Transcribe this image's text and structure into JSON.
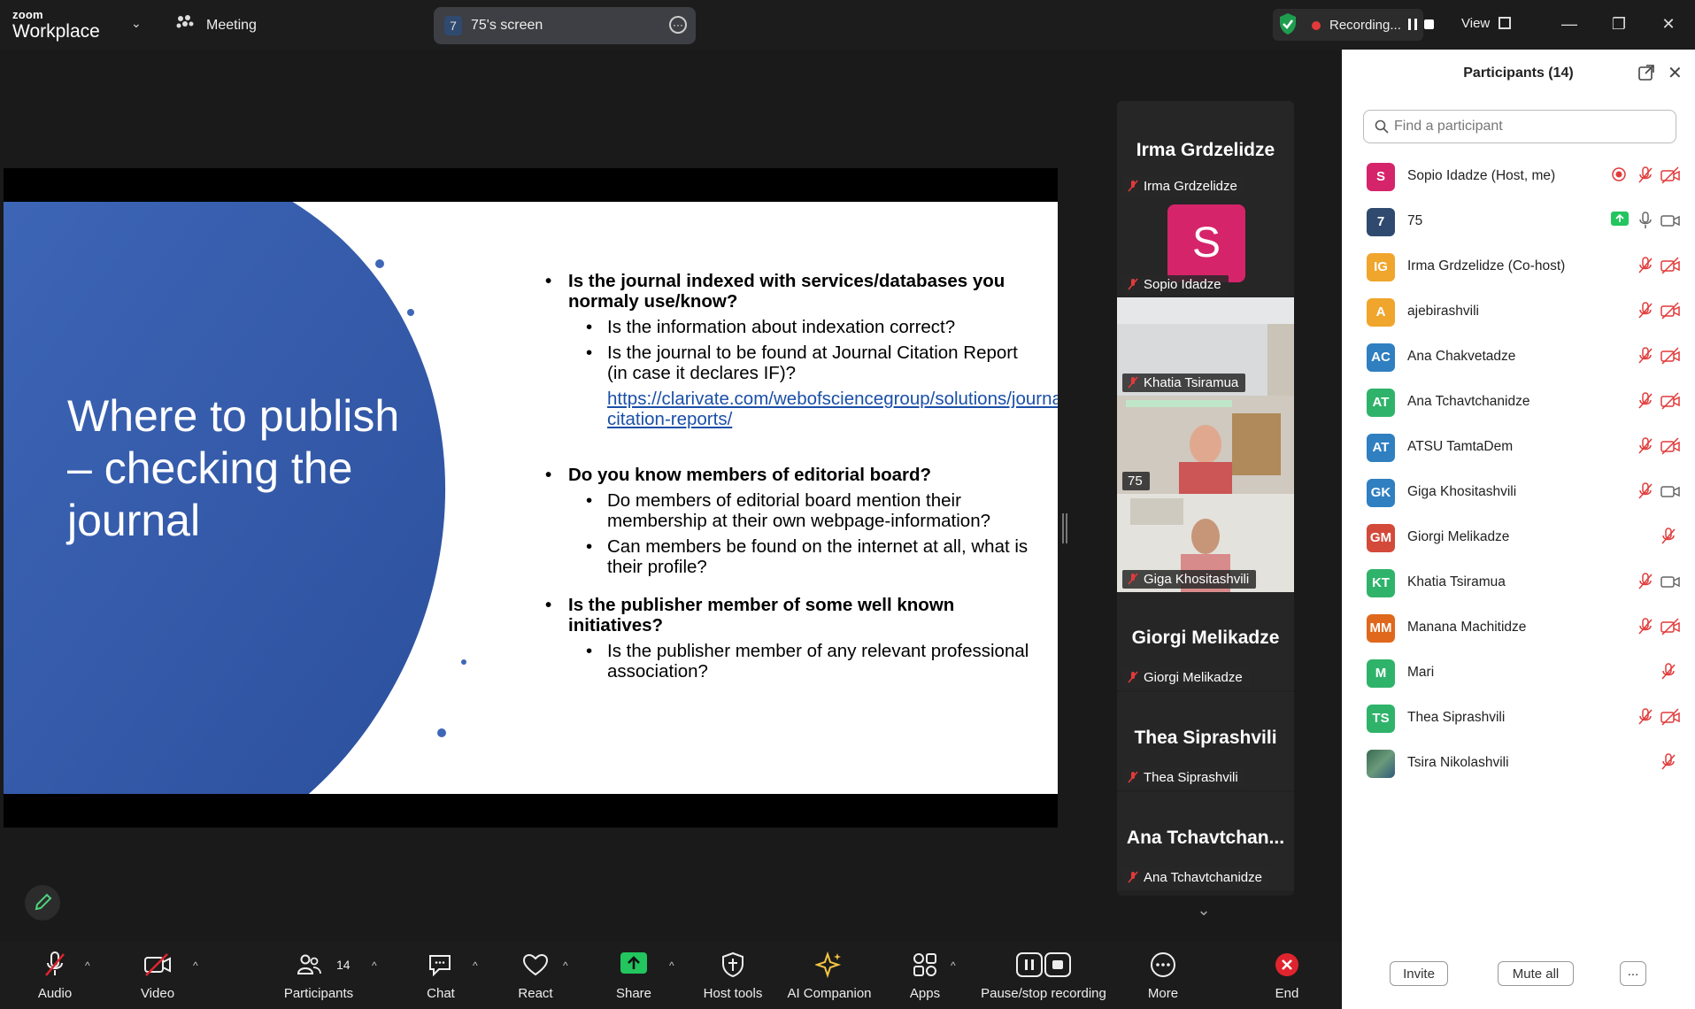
{
  "app": {
    "brand_small": "zoom",
    "brand_large": "Workplace",
    "meeting_label": "Meeting",
    "screen_share": {
      "number": "7",
      "label": "75's screen"
    },
    "recording_label": "Recording...",
    "view_label": "View"
  },
  "slide": {
    "title": "Where to publish – checking the journal",
    "bullets": [
      {
        "text": "Is the journal indexed with services/databases you normaly use/know?",
        "sub": [
          "Is the information about indexation correct?",
          "Is the journal to be found at Journal Citation Report (in case it declares IF)?"
        ],
        "link": "https://clarivate.com/webofsciencegroup/solutions/journal-citation-reports/"
      },
      {
        "text": "Do you know members of editorial board?",
        "sub": [
          "Do members of editorial board mention their membership at their own webpage-information?",
          "Can members be found on the internet at all, what is their profile?"
        ]
      },
      {
        "text": "Is the publisher member of some well known initiatives?",
        "sub": [
          "Is the publisher member of any relevant professional association?"
        ]
      }
    ]
  },
  "gallery": {
    "tiles": [
      {
        "display": "Irma Grdzelidze",
        "tag": "Irma Grdzelidze"
      },
      {
        "avatar": "S",
        "tag": "Sopio Idadze"
      },
      {
        "tag": "Khatia Tsiramua"
      },
      {
        "tag": "75"
      },
      {
        "tag": "Giga Khositashvili"
      },
      {
        "display": "Giorgi Melikadze",
        "tag": "Giorgi Melikadze"
      },
      {
        "display": "Thea Siprashvili",
        "tag": "Thea Siprashvili"
      },
      {
        "display": "Ana  Tchavtchan...",
        "tag": "Ana Tchavtchanidze"
      }
    ]
  },
  "participants_panel": {
    "title": "Participants (14)",
    "search_placeholder": "Find a participant",
    "participants": [
      {
        "initials": "S",
        "name": "Sopio Idadze (Host, me)",
        "color": "#d5246a"
      },
      {
        "initials": "7",
        "name": "75",
        "color": "#2f4a6e"
      },
      {
        "initials": "IG",
        "name": "Irma Grdzelidze (Co-host)",
        "color": "#f0a52c"
      },
      {
        "initials": "A",
        "name": "ajebirashvili",
        "color": "#f0a52c"
      },
      {
        "initials": "AC",
        "name": "Ana Chakvetadze",
        "color": "#2f7fc1"
      },
      {
        "initials": "AT",
        "name": "Ana Tchavtchanidze",
        "color": "#2fb36a"
      },
      {
        "initials": "AT",
        "name": "ATSU TamtaDem",
        "color": "#2f7fc1"
      },
      {
        "initials": "GK",
        "name": "Giga Khositashvili",
        "color": "#2f7fc1"
      },
      {
        "initials": "GM",
        "name": "Giorgi Melikadze",
        "color": "#d34a3a"
      },
      {
        "initials": "KT",
        "name": "Khatia Tsiramua",
        "color": "#2fb36a"
      },
      {
        "initials": "MM",
        "name": "Manana Machitidze",
        "color": "#e0681c"
      },
      {
        "initials": "M",
        "name": "Mari",
        "color": "#2fb36a"
      },
      {
        "initials": "TS",
        "name": "Thea Siprashvili",
        "color": "#2fb36a"
      },
      {
        "initials": "",
        "name": "Tsira Nikolashvili",
        "color": "#4b7b5a"
      }
    ],
    "invite_label": "Invite",
    "mute_all_label": "Mute all",
    "more_label": "..."
  },
  "toolbar": {
    "audio": "Audio",
    "video": "Video",
    "participants": "Participants",
    "participants_count": "14",
    "chat": "Chat",
    "react": "React",
    "share": "Share",
    "host_tools": "Host tools",
    "ai_companion": "AI Companion",
    "apps": "Apps",
    "pause_recording": "Pause/stop recording",
    "more": "More",
    "end": "End"
  },
  "colors": {
    "accent_green": "#39d38b",
    "end_red": "#e0242e",
    "share_green": "#22c55e"
  }
}
